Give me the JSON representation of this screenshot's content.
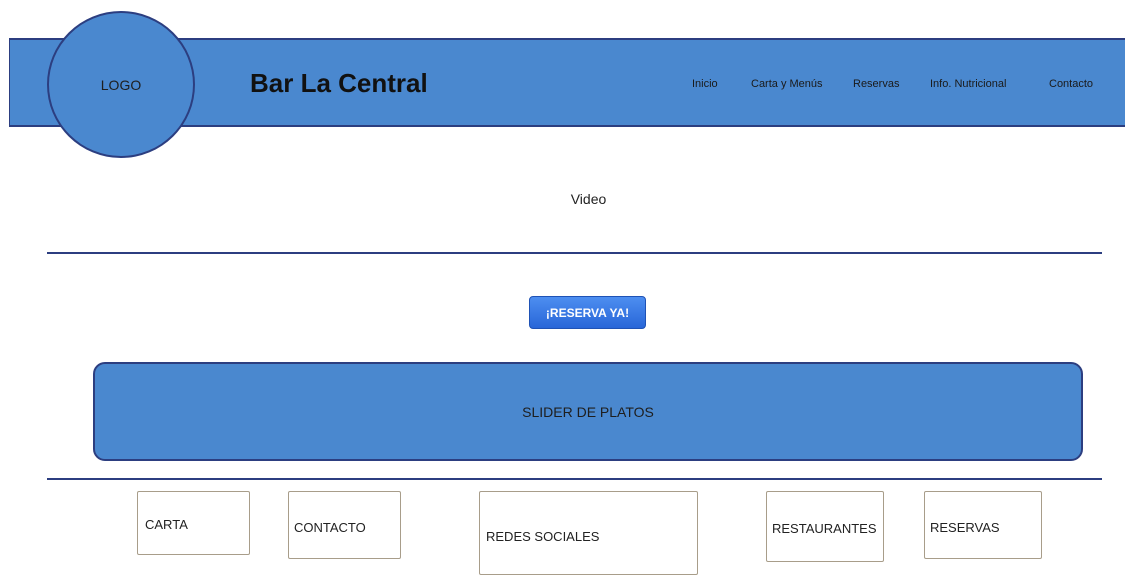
{
  "header": {
    "logo_label": "LOGO",
    "title": "Bar La Central",
    "nav": [
      "Inicio",
      "Carta y Menús",
      "Reservas",
      "Info. Nutricional",
      "Contacto"
    ]
  },
  "main": {
    "video_label": "Video",
    "reserve_button": "¡RESERVA YA!",
    "slider_label": "SLIDER DE PLATOS"
  },
  "footer": {
    "boxes": [
      "CARTA",
      "CONTACTO",
      "REDES SOCIALES",
      "RESTAURANTES",
      "RESERVAS"
    ]
  },
  "colors": {
    "header_bg": "#4a88cf",
    "border": "#2c3e80",
    "button": "#2866d8"
  }
}
